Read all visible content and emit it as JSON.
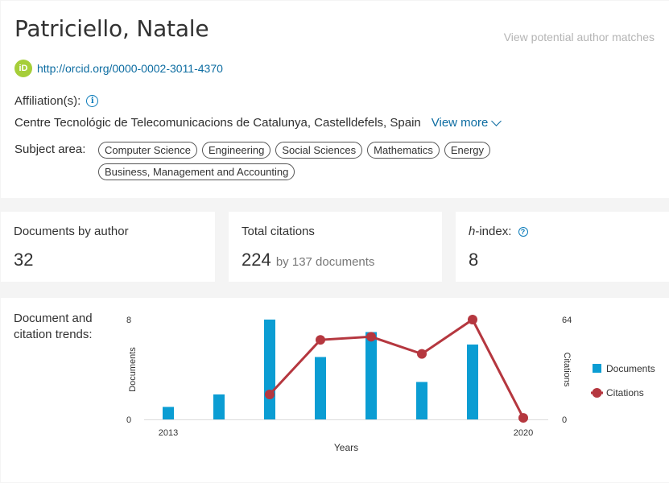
{
  "author": {
    "name": "Patriciello, Natale",
    "potential_matches_label": "View potential author matches",
    "orcid_icon_text": "iD",
    "orcid_url": "http://orcid.org/0000-0002-3011-4370"
  },
  "affiliation": {
    "label": "Affiliation(s):",
    "info_icon_text": "i",
    "value": "Centre Tecnológic de Telecomunicacions de Catalunya, Castelldefels, Spain",
    "view_more_label": "View more"
  },
  "subject_area": {
    "label": "Subject area:",
    "chips": [
      "Computer Science",
      "Engineering",
      "Social Sciences",
      "Mathematics",
      "Energy",
      "Business, Management and Accounting"
    ]
  },
  "metrics": {
    "documents_label": "Documents by author",
    "documents_value": "32",
    "citations_label": "Total citations",
    "citations_value": "224",
    "citations_sub": "by 137 documents",
    "hindex_label_italic": "h",
    "hindex_label_rest": "-index:",
    "hindex_help_icon": "?",
    "hindex_value": "8"
  },
  "trends": {
    "label_line1": "Document and",
    "label_line2": "citation trends:"
  },
  "chart_data": {
    "type": "bar",
    "x": [
      2013,
      2014,
      2015,
      2016,
      2017,
      2018,
      2019,
      2020
    ],
    "xlabel": "Years",
    "x_tick_labels": [
      "2013",
      "2020"
    ],
    "y_left": {
      "label": "Documents",
      "min": 0,
      "max": 8,
      "tick_labels": [
        "0",
        "8"
      ]
    },
    "y_right": {
      "label": "Citations",
      "min": 0,
      "max": 64,
      "tick_labels": [
        "0",
        "64"
      ]
    },
    "series": [
      {
        "name": "Documents",
        "type": "bar",
        "axis": "left",
        "color": "#0b9dd3",
        "values": [
          1,
          2,
          8,
          5,
          7,
          3,
          6,
          null
        ]
      },
      {
        "name": "Citations",
        "type": "line",
        "axis": "right",
        "color": "#b5373f",
        "values": [
          null,
          null,
          16,
          51,
          53,
          42,
          64,
          1
        ]
      }
    ],
    "legend_position": "right",
    "grid": false
  }
}
